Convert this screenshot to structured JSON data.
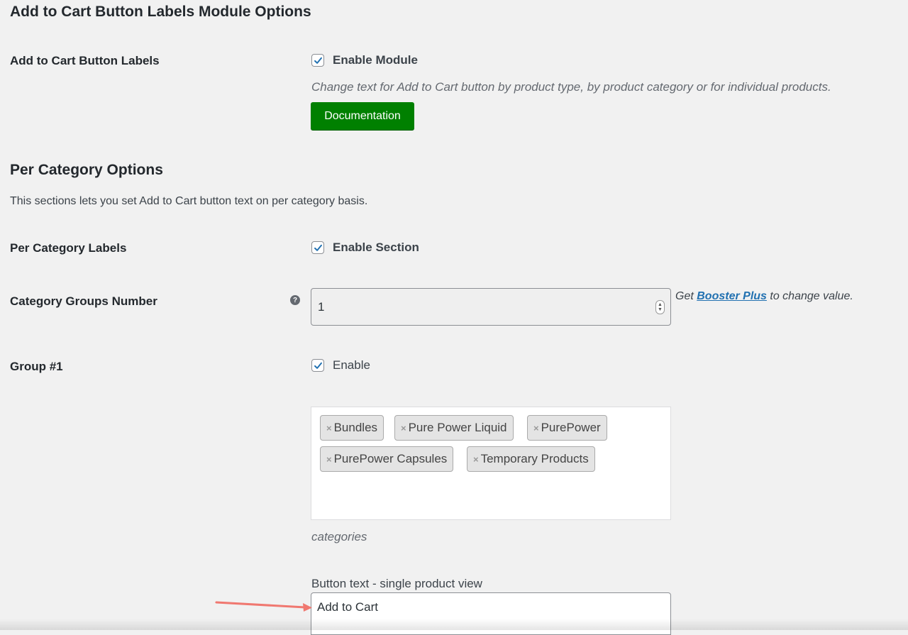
{
  "module": {
    "title": "Add to Cart Button Labels Module Options",
    "row_label": "Add to Cart Button Labels",
    "enable_label": "Enable Module",
    "enable_checked": true,
    "description": "Change text for Add to Cart button by product type, by product category or for individual products.",
    "doc_button": "Documentation"
  },
  "per_category": {
    "title": "Per Category Options",
    "description": "This sections lets you set Add to Cart button text on per category basis.",
    "labels_row": "Per Category Labels",
    "enable_section_label": "Enable Section",
    "enable_section_checked": true,
    "groups_number_label": "Category Groups Number",
    "help_icon": "?",
    "groups_number_value": "1",
    "booster_prefix": "Get",
    "booster_link": "Booster Plus",
    "booster_suffix": "to change value."
  },
  "group1": {
    "label": "Group #1",
    "enable_label": "Enable",
    "enable_checked": true,
    "categories": [
      "Bundles",
      "Pure Power Liquid",
      "PurePower",
      "PurePower Capsules",
      "Temporary Products"
    ],
    "remove_glyph": "×",
    "categories_caption": "categories",
    "button_text_label": "Button text - single product view",
    "button_text_value": "Add to Cart"
  },
  "annotation": {
    "arrow_color": "#f07870"
  },
  "colors": {
    "doc_button_bg": "#008000",
    "checkbox_check": "#2271b1",
    "link": "#2271b1",
    "background": "#f1f1f1"
  }
}
